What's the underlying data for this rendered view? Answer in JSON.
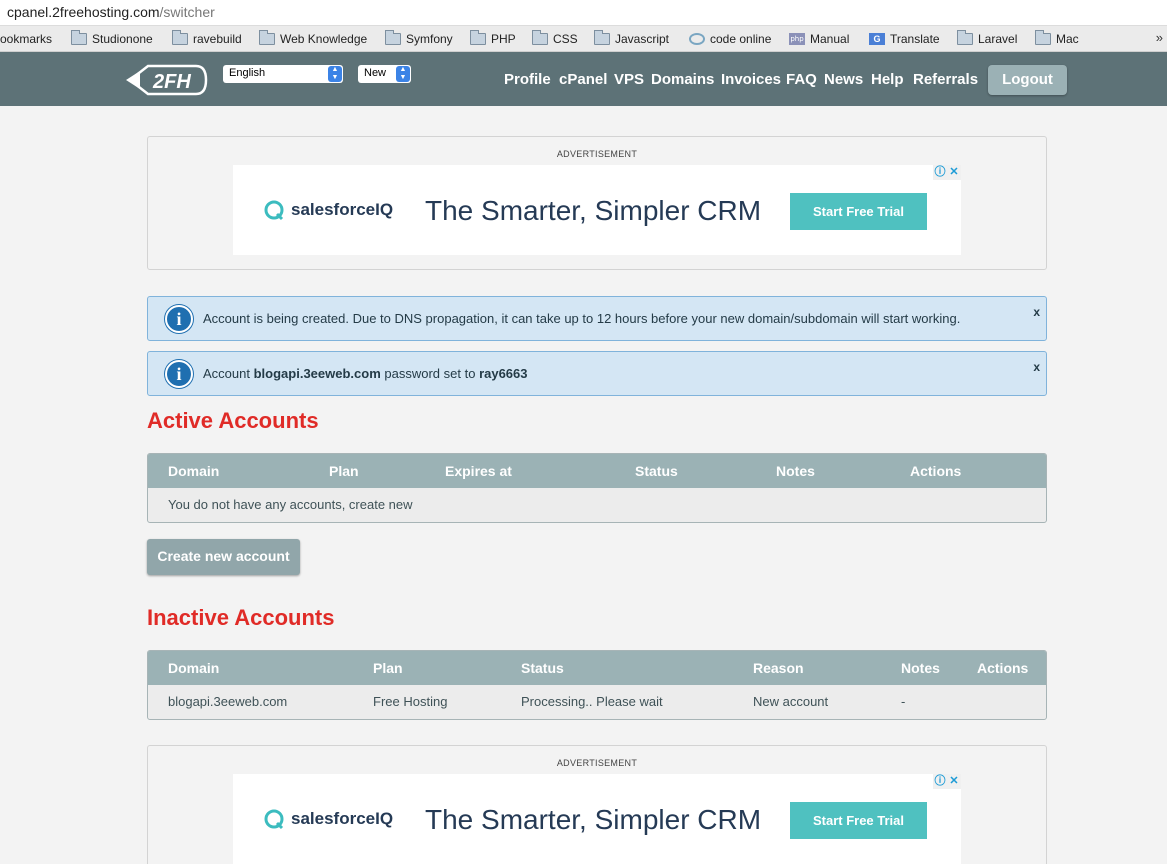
{
  "browser": {
    "url_host": "cpanel.2freehosting.com",
    "url_path": "/switcher",
    "bookmarks": [
      {
        "label": "ookmarks",
        "icon": "none"
      },
      {
        "label": "Studionone",
        "icon": "folder-icon"
      },
      {
        "label": "ravebuild",
        "icon": "folder-icon"
      },
      {
        "label": "Web Knowledge",
        "icon": "folder-icon"
      },
      {
        "label": "Symfony",
        "icon": "folder-icon"
      },
      {
        "label": "PHP",
        "icon": "folder-icon"
      },
      {
        "label": "CSS",
        "icon": "folder-icon"
      },
      {
        "label": "Javascript",
        "icon": "folder-icon"
      },
      {
        "label": "code online",
        "icon": "code-icon"
      },
      {
        "label": "Manual",
        "icon": "php-icon"
      },
      {
        "label": "Translate",
        "icon": "translate-icon"
      },
      {
        "label": "Laravel",
        "icon": "folder-icon"
      },
      {
        "label": "Mac",
        "icon": "folder-icon"
      }
    ],
    "more": "»"
  },
  "header": {
    "logo_text": "2FH",
    "language": "English",
    "theme": "New",
    "nav": [
      "Profile",
      "cPanel",
      "VPS",
      "Domains",
      "Invoices",
      "FAQ",
      "News",
      "Help",
      "Referrals"
    ],
    "logout": "Logout"
  },
  "ads": {
    "label": "ADVERTISEMENT",
    "brand": "salesforceIQ",
    "headline": "The Smarter, Simpler CRM",
    "cta": "Start Free Trial",
    "icons": [
      "info-icon",
      "close-icon"
    ]
  },
  "alerts": {
    "creating": "Account is being created. Due to DNS propagation, it can take up to 12 hours before your new domain/subdomain will start working.",
    "password_prefix": "Account",
    "password_domain": "blogapi.3eeweb.com",
    "password_middle": "password set to",
    "password_value": "ray6663",
    "close": "x"
  },
  "active": {
    "title": "Active Accounts",
    "columns": [
      "Domain",
      "Plan",
      "Expires at",
      "Status",
      "Notes",
      "Actions"
    ],
    "empty": "You do not have any accounts, create new"
  },
  "create_button": "Create new account",
  "inactive": {
    "title": "Inactive Accounts",
    "columns": [
      "Domain",
      "Plan",
      "Status",
      "Reason",
      "Notes",
      "Actions"
    ],
    "rows": [
      {
        "domain": "blogapi.3eeweb.com",
        "plan": "Free Hosting",
        "status": "Processing.. Please wait",
        "reason": "New account",
        "notes": "-",
        "actions": ""
      }
    ]
  },
  "colors": {
    "header_bg": "#5d7277",
    "heading_red": "#e02b27",
    "table_head": "#9bb2b5",
    "alert_bg": "#d4e6f4",
    "cta": "#4fc1c0"
  }
}
